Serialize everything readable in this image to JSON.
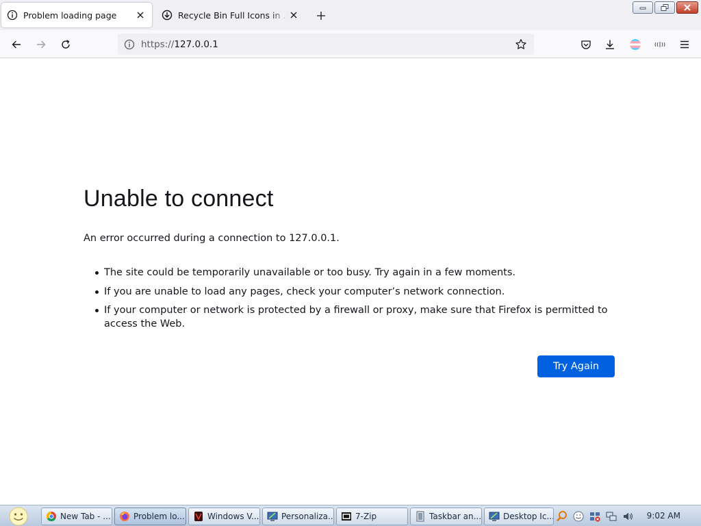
{
  "tabs": [
    {
      "label": "Problem loading page",
      "active": true
    },
    {
      "label": "Recycle Bin Full Icons in .svg .png",
      "active": false
    }
  ],
  "window_controls": [
    "minimize",
    "restore",
    "close"
  ],
  "navbar": {
    "url_scheme": "https://",
    "url_host": "127.0.0.1",
    "icons": [
      "back-icon",
      "forward-icon",
      "reload-icon",
      "info-icon",
      "star-icon",
      "pocket-icon",
      "download-icon",
      "account-icon",
      "extension-icon",
      "menu-icon"
    ]
  },
  "error": {
    "title": "Unable to connect",
    "description": "An error occurred during a connection to 127.0.0.1.",
    "bullets": [
      "The site could be temporarily unavailable or too busy. Try again in a few moments.",
      "If you are unable to load any pages, check your computer’s network connection.",
      "If your computer or network is protected by a firewall or proxy, make sure that Firefox is permitted to access the Web."
    ],
    "button_label": "Try Again"
  },
  "taskbar": {
    "items": [
      {
        "label": "New Tab - ..."
      },
      {
        "label": "Problem lo..."
      },
      {
        "label": "Windows V..."
      },
      {
        "label": "Personaliza..."
      },
      {
        "label": "7-Zip"
      },
      {
        "label": "Taskbar an..."
      },
      {
        "label": "Desktop Ic..."
      }
    ],
    "clock": "9:02 AM"
  },
  "colors": {
    "accent": "#0061e0",
    "tabstrip": "#f0f0f4",
    "toolbar": "#f9f9fb",
    "text": "#15141a"
  }
}
